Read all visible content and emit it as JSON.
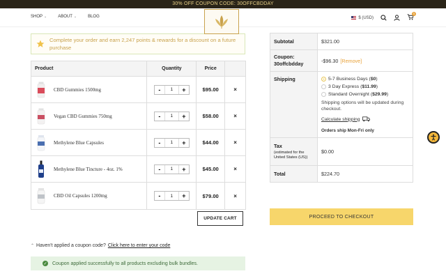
{
  "promo": {
    "text": "30% OFF COUPON CODE: 30OFFCBDDAY"
  },
  "header": {
    "nav": [
      {
        "label": "SHOP",
        "has_dropdown": true
      },
      {
        "label": "ABOUT",
        "has_dropdown": true
      },
      {
        "label": "BLOG",
        "has_dropdown": false
      }
    ],
    "currency": "$ (USD)",
    "cart_count": "5",
    "icons": [
      "us-flag-icon",
      "search-icon",
      "user-icon",
      "cart-icon"
    ]
  },
  "points_banner": {
    "text": "Complete your order and earn 2,247 points & rewards for a discount on a future purchase",
    "icon": "star-icon",
    "color": "#c9a24d"
  },
  "cart": {
    "headers": {
      "product": "Product",
      "quantity": "Quantity",
      "price": "Price",
      "remove": ""
    },
    "items": [
      {
        "name": "CBD Gummies 1500mg",
        "qty": "1",
        "price": "$95.00",
        "thumb_color": "#d94b5a"
      },
      {
        "name": "Vegan CBD Gummies 750mg",
        "qty": "1",
        "price": "$58.00",
        "thumb_color": "#c94f62"
      },
      {
        "name": "Methylene Blue Capsules",
        "qty": "1",
        "price": "$44.00",
        "thumb_color": "#4a6fb0"
      },
      {
        "name": "Methylene Blue Tincture - 4oz. 1%",
        "qty": "1",
        "price": "$45.00",
        "thumb_color": "#1f3f8a"
      },
      {
        "name": "CBD Oil Capsules 1200mg",
        "qty": "1",
        "price": "$79.00",
        "thumb_color": "#bfc3c8"
      }
    ],
    "minus_label": "-",
    "plus_label": "+",
    "remove_label": "×",
    "update_label": "UPDATE CART"
  },
  "coupon": {
    "prompt": "Haven't applied a coupon code?",
    "link": "Click here to enter your code",
    "success": "Coupon applied successfully to all products excluding bulk bundles."
  },
  "summary": {
    "subtotal_label": "Subtotal",
    "subtotal": "$321.00",
    "coupon_label": "Coupon: 30offcbdday",
    "coupon_value": "-$96.30",
    "remove_link": "[Remove]",
    "shipping_label": "Shipping",
    "shipping_options": [
      {
        "label": "5-7 Business Days (",
        "price": "$0",
        "suffix": ")",
        "selected": true
      },
      {
        "label": "3 Day Express (",
        "price": "$11.99",
        "suffix": ")",
        "selected": false
      },
      {
        "label": "Standard Overnight (",
        "price": "$29.99",
        "suffix": ")",
        "selected": false
      }
    ],
    "shipping_note": "Shipping options will be updated during checkout.",
    "calc_link": "Calculate shipping",
    "ship_days": "Orders ship Mon-Fri only",
    "tax_label": "Tax",
    "tax_sub": "(estimated for the United States (US))",
    "tax": "$0.00",
    "total_label": "Total",
    "total": "$224.70",
    "checkout_label": "PROCEED TO CHECKOUT",
    "accent": "#f7d66b"
  }
}
